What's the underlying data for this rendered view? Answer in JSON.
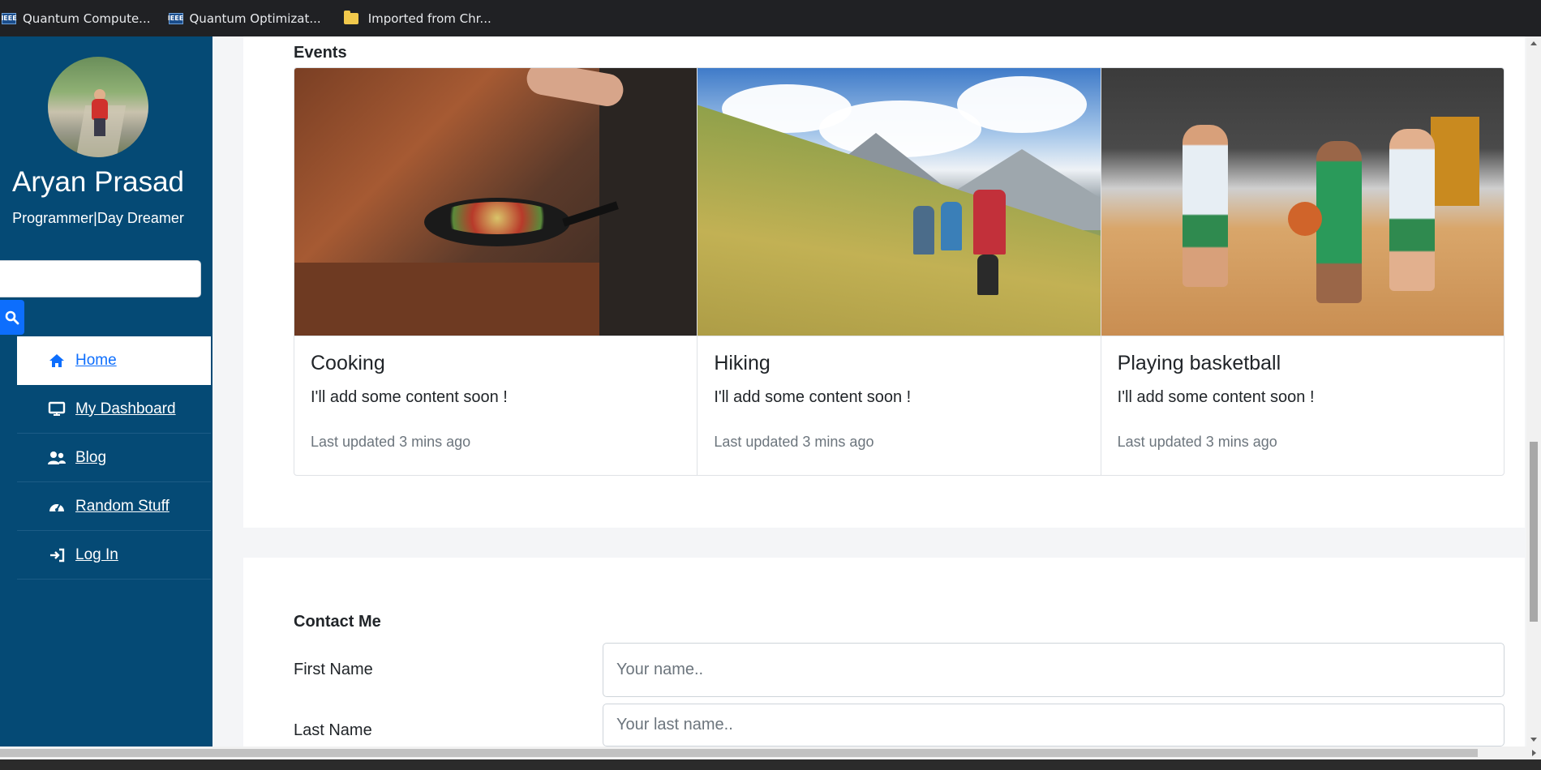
{
  "bookmarks": [
    {
      "label": "Quantum Compute...",
      "icon": "ieee-icon"
    },
    {
      "label": "Quantum Optimizat...",
      "icon": "ieee-icon"
    },
    {
      "label": "Imported from Chr...",
      "icon": "folder-icon"
    }
  ],
  "profile": {
    "name": "Aryan Prasad",
    "tagline": "Programmer|Day Dreamer"
  },
  "search": {
    "placeholder": ""
  },
  "nav": [
    {
      "label": " Home",
      "icon": "home-icon",
      "active": true
    },
    {
      "label": " My Dashboard",
      "icon": "monitor-icon",
      "active": false
    },
    {
      "label": " Blog",
      "icon": "users-icon",
      "active": false
    },
    {
      "label": " Random Stuff",
      "icon": "gauge-icon",
      "active": false
    },
    {
      "label": " Log In",
      "icon": "sign-in-icon",
      "active": false
    }
  ],
  "events": {
    "title": "Events",
    "cards": [
      {
        "title": "Cooking",
        "text": "I'll add some content soon !",
        "updated": "Last updated 3 mins ago",
        "image": "cooking-photo"
      },
      {
        "title": "Hiking",
        "text": "I'll add some content soon !",
        "updated": "Last updated 3 mins ago",
        "image": "hiking-photo"
      },
      {
        "title": "Playing basketball",
        "text": "I'll add some content soon !",
        "updated": "Last updated 3 mins ago",
        "image": "basketball-photo"
      }
    ]
  },
  "contact": {
    "title": "Contact Me",
    "first_name_label": "First Name",
    "first_name_placeholder": "Your name..",
    "last_name_label": "Last Name",
    "last_name_placeholder": "Your last name.."
  },
  "colors": {
    "sidebar": "#054a75",
    "accent": "#0d6efd"
  }
}
